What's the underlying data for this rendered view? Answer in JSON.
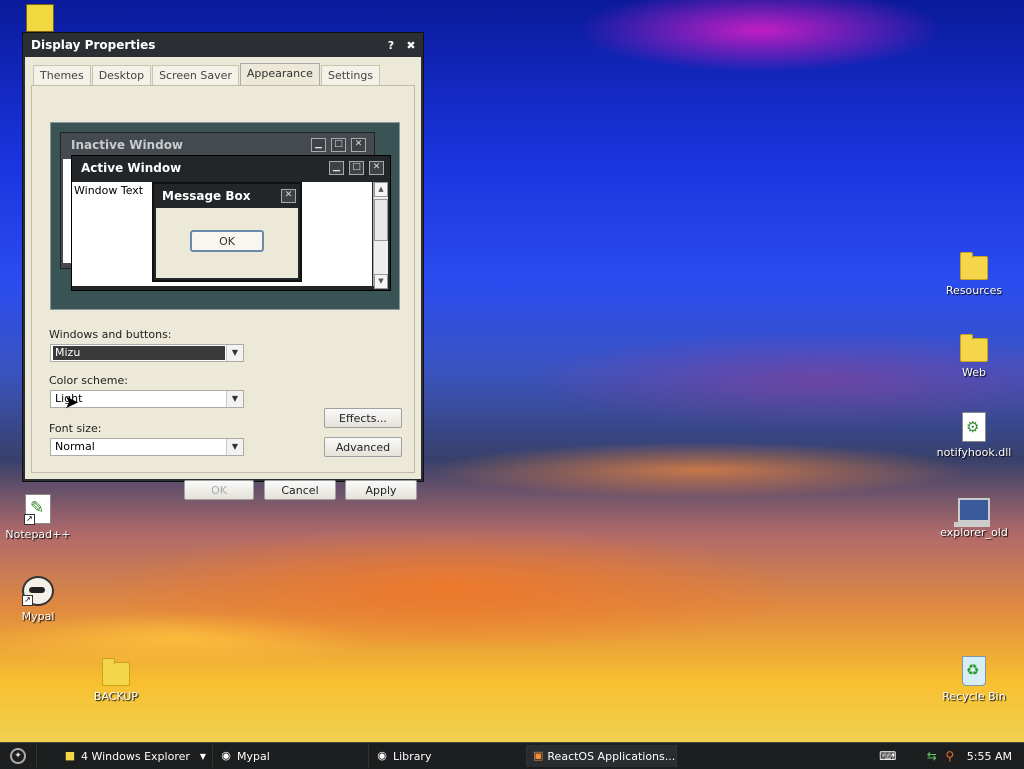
{
  "desktop": {
    "icons_left": [
      {
        "label": "Notepad++",
        "icon": "notepadpp-icon"
      },
      {
        "label": "Mypal",
        "icon": "mypal-icon"
      },
      {
        "label": "BACKUP",
        "icon": "folder-icon"
      }
    ],
    "icons_right": [
      {
        "label": "Resources",
        "icon": "folder-icon"
      },
      {
        "label": "Web",
        "icon": "folder-icon"
      },
      {
        "label": "notifyhook.dll",
        "icon": "dll-icon"
      },
      {
        "label": "explorer_old",
        "icon": "computer-icon"
      },
      {
        "label": "Recycle Bin",
        "icon": "recycle-bin-icon"
      }
    ]
  },
  "dialog": {
    "title": "Display Properties",
    "help_glyph": "?",
    "close_glyph": "✖",
    "tabs": [
      {
        "label": "Themes"
      },
      {
        "label": "Desktop"
      },
      {
        "label": "Screen Saver"
      },
      {
        "label": "Appearance",
        "active": true
      },
      {
        "label": "Settings"
      }
    ],
    "preview": {
      "inactive_title": "Inactive Window",
      "active_title": "Active Window",
      "window_text": "Window Text",
      "message_box_title": "Message Box",
      "ok_label": "OK"
    },
    "windows_buttons_label": "Windows and buttons:",
    "windows_buttons_value": "Mizu",
    "color_scheme_label": "Color scheme:",
    "color_scheme_value": "Light",
    "font_size_label": "Font size:",
    "font_size_value": "Normal",
    "effects_label": "Effects...",
    "advanced_label": "Advanced",
    "ok_label": "OK",
    "cancel_label": "Cancel",
    "apply_label": "Apply"
  },
  "taskbar": {
    "start_icon": "reactos-start-icon",
    "tasks": [
      {
        "label": "4 Windows Explorer",
        "icon": "folder-icon"
      },
      {
        "label": "Mypal",
        "icon": "mypal-icon"
      },
      {
        "label": "Library",
        "icon": "library-icon"
      },
      {
        "label": "ReactOS Applications...",
        "icon": "app-manager-icon"
      }
    ],
    "clock": "5:55 AM"
  },
  "colors": {
    "window_frame": "#2b2f33",
    "dialog_face": "#ece9d8",
    "taskbar": "#1c1e20"
  }
}
